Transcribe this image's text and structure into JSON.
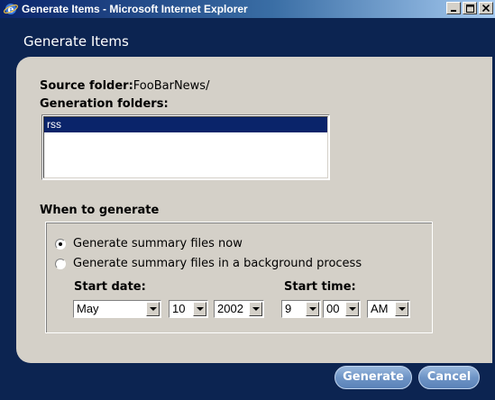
{
  "window": {
    "title": "Generate Items - Microsoft Internet Explorer",
    "icon": "ie-icon"
  },
  "dialog": {
    "title": "Generate Items",
    "source_folder_label": "Source folder:",
    "source_folder_value": "FooBarNews/",
    "generation_folders_label": "Generation folders:",
    "generation_folders": [
      {
        "label": "rss",
        "selected": true
      }
    ],
    "when_label": "When to generate",
    "options": [
      {
        "label": "Generate summary files now",
        "checked": true
      },
      {
        "label": "Generate summary files in a background process",
        "checked": false
      }
    ],
    "start_date_label": "Start date:",
    "start_time_label": "Start time:",
    "start_date": {
      "month": "May",
      "day": "10",
      "year": "2002"
    },
    "start_time": {
      "hour": "9",
      "minute": "00",
      "ampm": "AM"
    }
  },
  "buttons": {
    "generate": "Generate",
    "cancel": "Cancel"
  },
  "colors": {
    "titlebar_start": "#0a246a",
    "dialog_background": "#0c2451",
    "panel": "#d4d0c8",
    "selection": "#0a246a",
    "button": "#6e94c6"
  }
}
